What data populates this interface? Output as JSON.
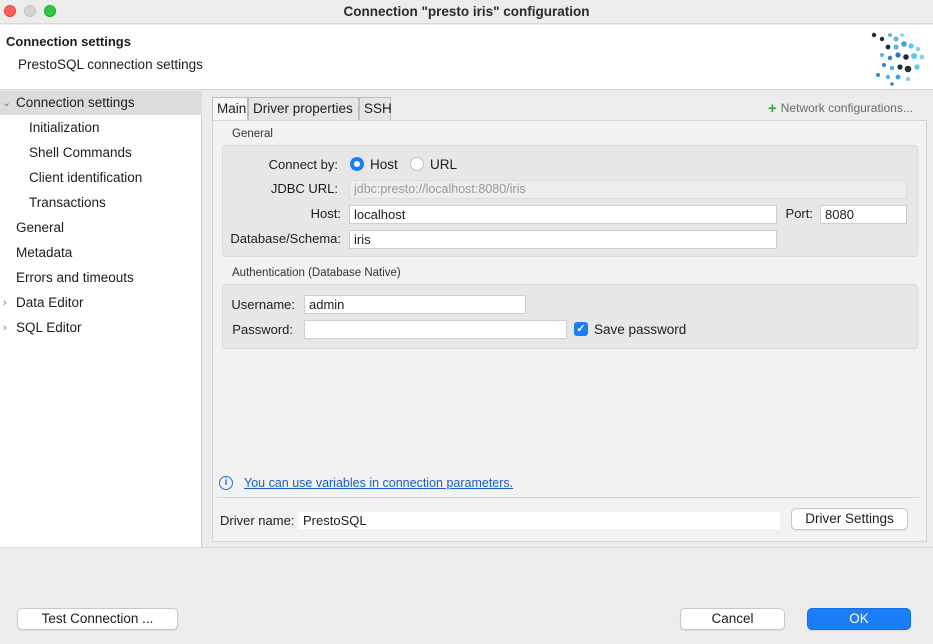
{
  "window": {
    "title": "Connection \"presto iris\" configuration"
  },
  "header": {
    "title": "Connection settings",
    "subtitle": "PrestoSQL connection settings"
  },
  "tree": {
    "items": [
      {
        "label": "Connection settings",
        "expanded": true,
        "selected": true
      },
      {
        "label": "Initialization"
      },
      {
        "label": "Shell Commands"
      },
      {
        "label": "Client identification"
      },
      {
        "label": "Transactions"
      },
      {
        "label": "General"
      },
      {
        "label": "Metadata"
      },
      {
        "label": "Errors and timeouts"
      },
      {
        "label": "Data Editor",
        "expanded": false
      },
      {
        "label": "SQL Editor",
        "expanded": false
      }
    ]
  },
  "tabs": [
    {
      "label": "Main",
      "active": true
    },
    {
      "label": "Driver properties"
    },
    {
      "label": "SSH"
    }
  ],
  "network_config": "Network configurations...",
  "general": {
    "section_label": "General",
    "connect_by_label": "Connect by:",
    "host_option": "Host",
    "url_option": "URL",
    "selected": "Host",
    "jdbc_label": "JDBC URL:",
    "jdbc_value": "jdbc:presto://localhost:8080/iris",
    "host_label": "Host:",
    "host_value": "localhost",
    "port_label": "Port:",
    "port_value": "8080",
    "db_label": "Database/Schema:",
    "db_value": "iris"
  },
  "auth": {
    "section_label": "Authentication (Database Native)",
    "username_label": "Username:",
    "username_value": "admin",
    "password_label": "Password:",
    "password_value": "",
    "save_password_label": "Save password",
    "save_password_checked": true
  },
  "info": {
    "link_text": "You can use variables in connection parameters."
  },
  "driver": {
    "label": "Driver name:",
    "value": "PrestoSQL",
    "settings_button": "Driver Settings"
  },
  "footer": {
    "test_button": "Test Connection ...",
    "cancel_button": "Cancel",
    "ok_button": "OK"
  },
  "colors": {
    "accent": "#1a7ef7",
    "link": "#1a5cc8",
    "plus_green": "#3aa935"
  }
}
